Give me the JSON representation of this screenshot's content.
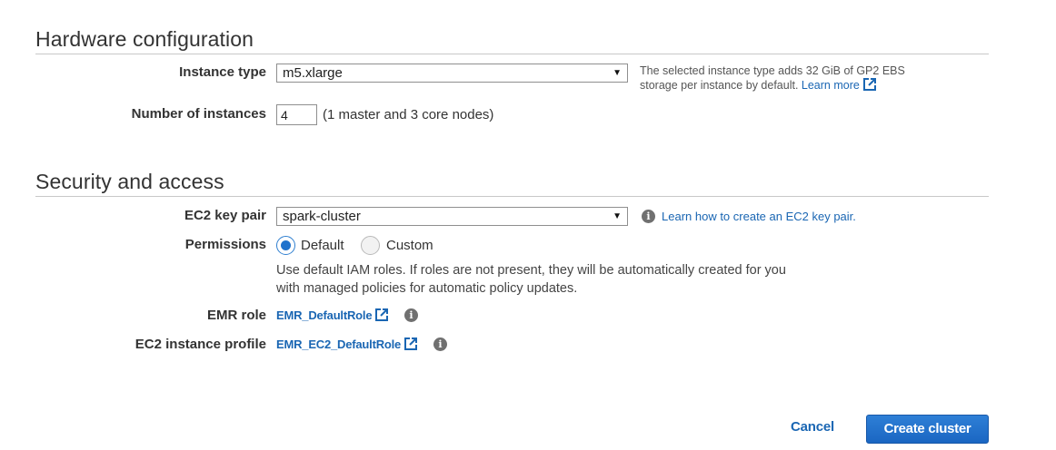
{
  "hardware": {
    "title": "Hardware configuration",
    "instance_type_label": "Instance type",
    "instance_type_value": "m5.xlarge",
    "instance_help": "The selected instance type adds 32 GiB of GP2 EBS storage per instance by default.",
    "learn_more": "Learn more",
    "num_instances_label": "Number of instances",
    "num_instances_value": "4",
    "num_instances_note": "(1 master and 3 core nodes)"
  },
  "security": {
    "title": "Security and access",
    "key_pair_label": "EC2 key pair",
    "key_pair_value": "spark-cluster",
    "key_pair_help_link": "Learn how to create an EC2 key pair.",
    "permissions_label": "Permissions",
    "permission_options": [
      {
        "label": "Default",
        "selected": true
      },
      {
        "label": "Custom",
        "selected": false
      }
    ],
    "permissions_description": "Use default IAM roles. If roles are not present, they will be automatically created for you with managed policies for automatic policy updates.",
    "emr_role_label": "EMR role",
    "emr_role_value": "EMR_DefaultRole",
    "instance_profile_label": "EC2 instance profile",
    "instance_profile_value": "EMR_EC2_DefaultRole"
  },
  "actions": {
    "cancel": "Cancel",
    "create": "Create cluster"
  },
  "icons": {
    "dropdown": "chevron-down-icon",
    "external": "external-link-icon",
    "info": "info-icon"
  },
  "colors": {
    "link": "#1a66b3",
    "primary_button": "#1f72cc",
    "radio_selected": "#1f72cc"
  }
}
